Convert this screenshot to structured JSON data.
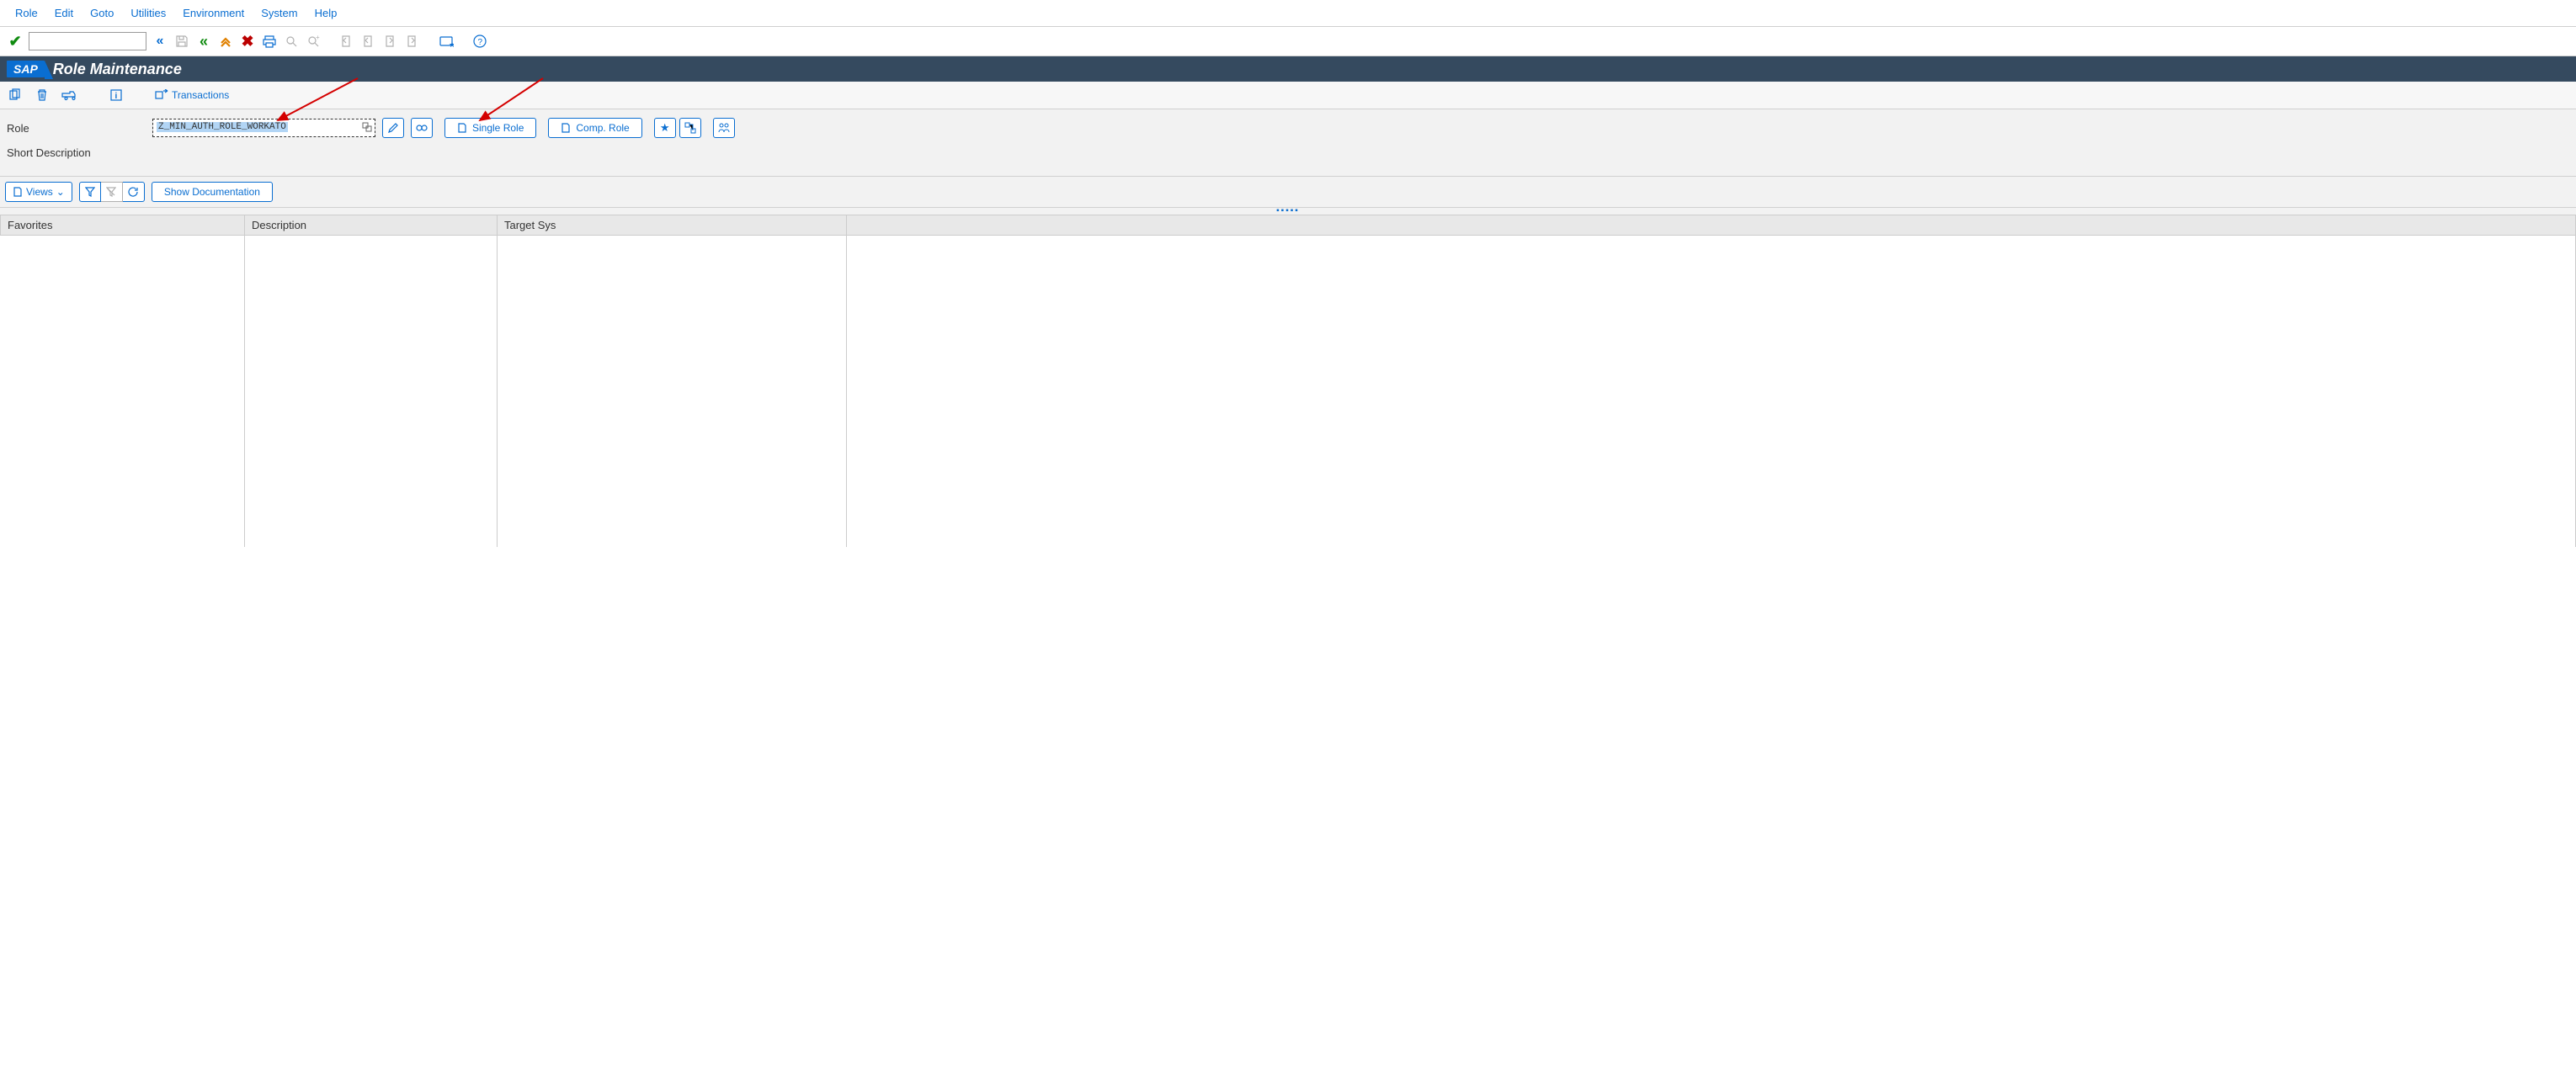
{
  "menu": {
    "role": "Role",
    "edit": "Edit",
    "goto": "Goto",
    "utilities": "Utilities",
    "environment": "Environment",
    "system": "System",
    "help": "Help"
  },
  "title": {
    "logo": "SAP",
    "text": "Role Maintenance"
  },
  "app_toolbar": {
    "transactions": "Transactions"
  },
  "form": {
    "role_label": "Role",
    "role_value": "Z_MIN_AUTH_ROLE_WORKATO",
    "short_desc_label": "Short Description",
    "single_role_btn": "Single Role",
    "comp_role_btn": "Comp. Role"
  },
  "table_toolbar": {
    "views": "Views",
    "show_doc": "Show Documentation"
  },
  "table": {
    "col_favorites": "Favorites",
    "col_description": "Description",
    "col_target": "Target Sys"
  },
  "colors": {
    "accent": "#0a6ed1",
    "header_bg": "#354a5f",
    "green": "#108b10",
    "orange": "#e08000",
    "red": "#bb0000"
  }
}
